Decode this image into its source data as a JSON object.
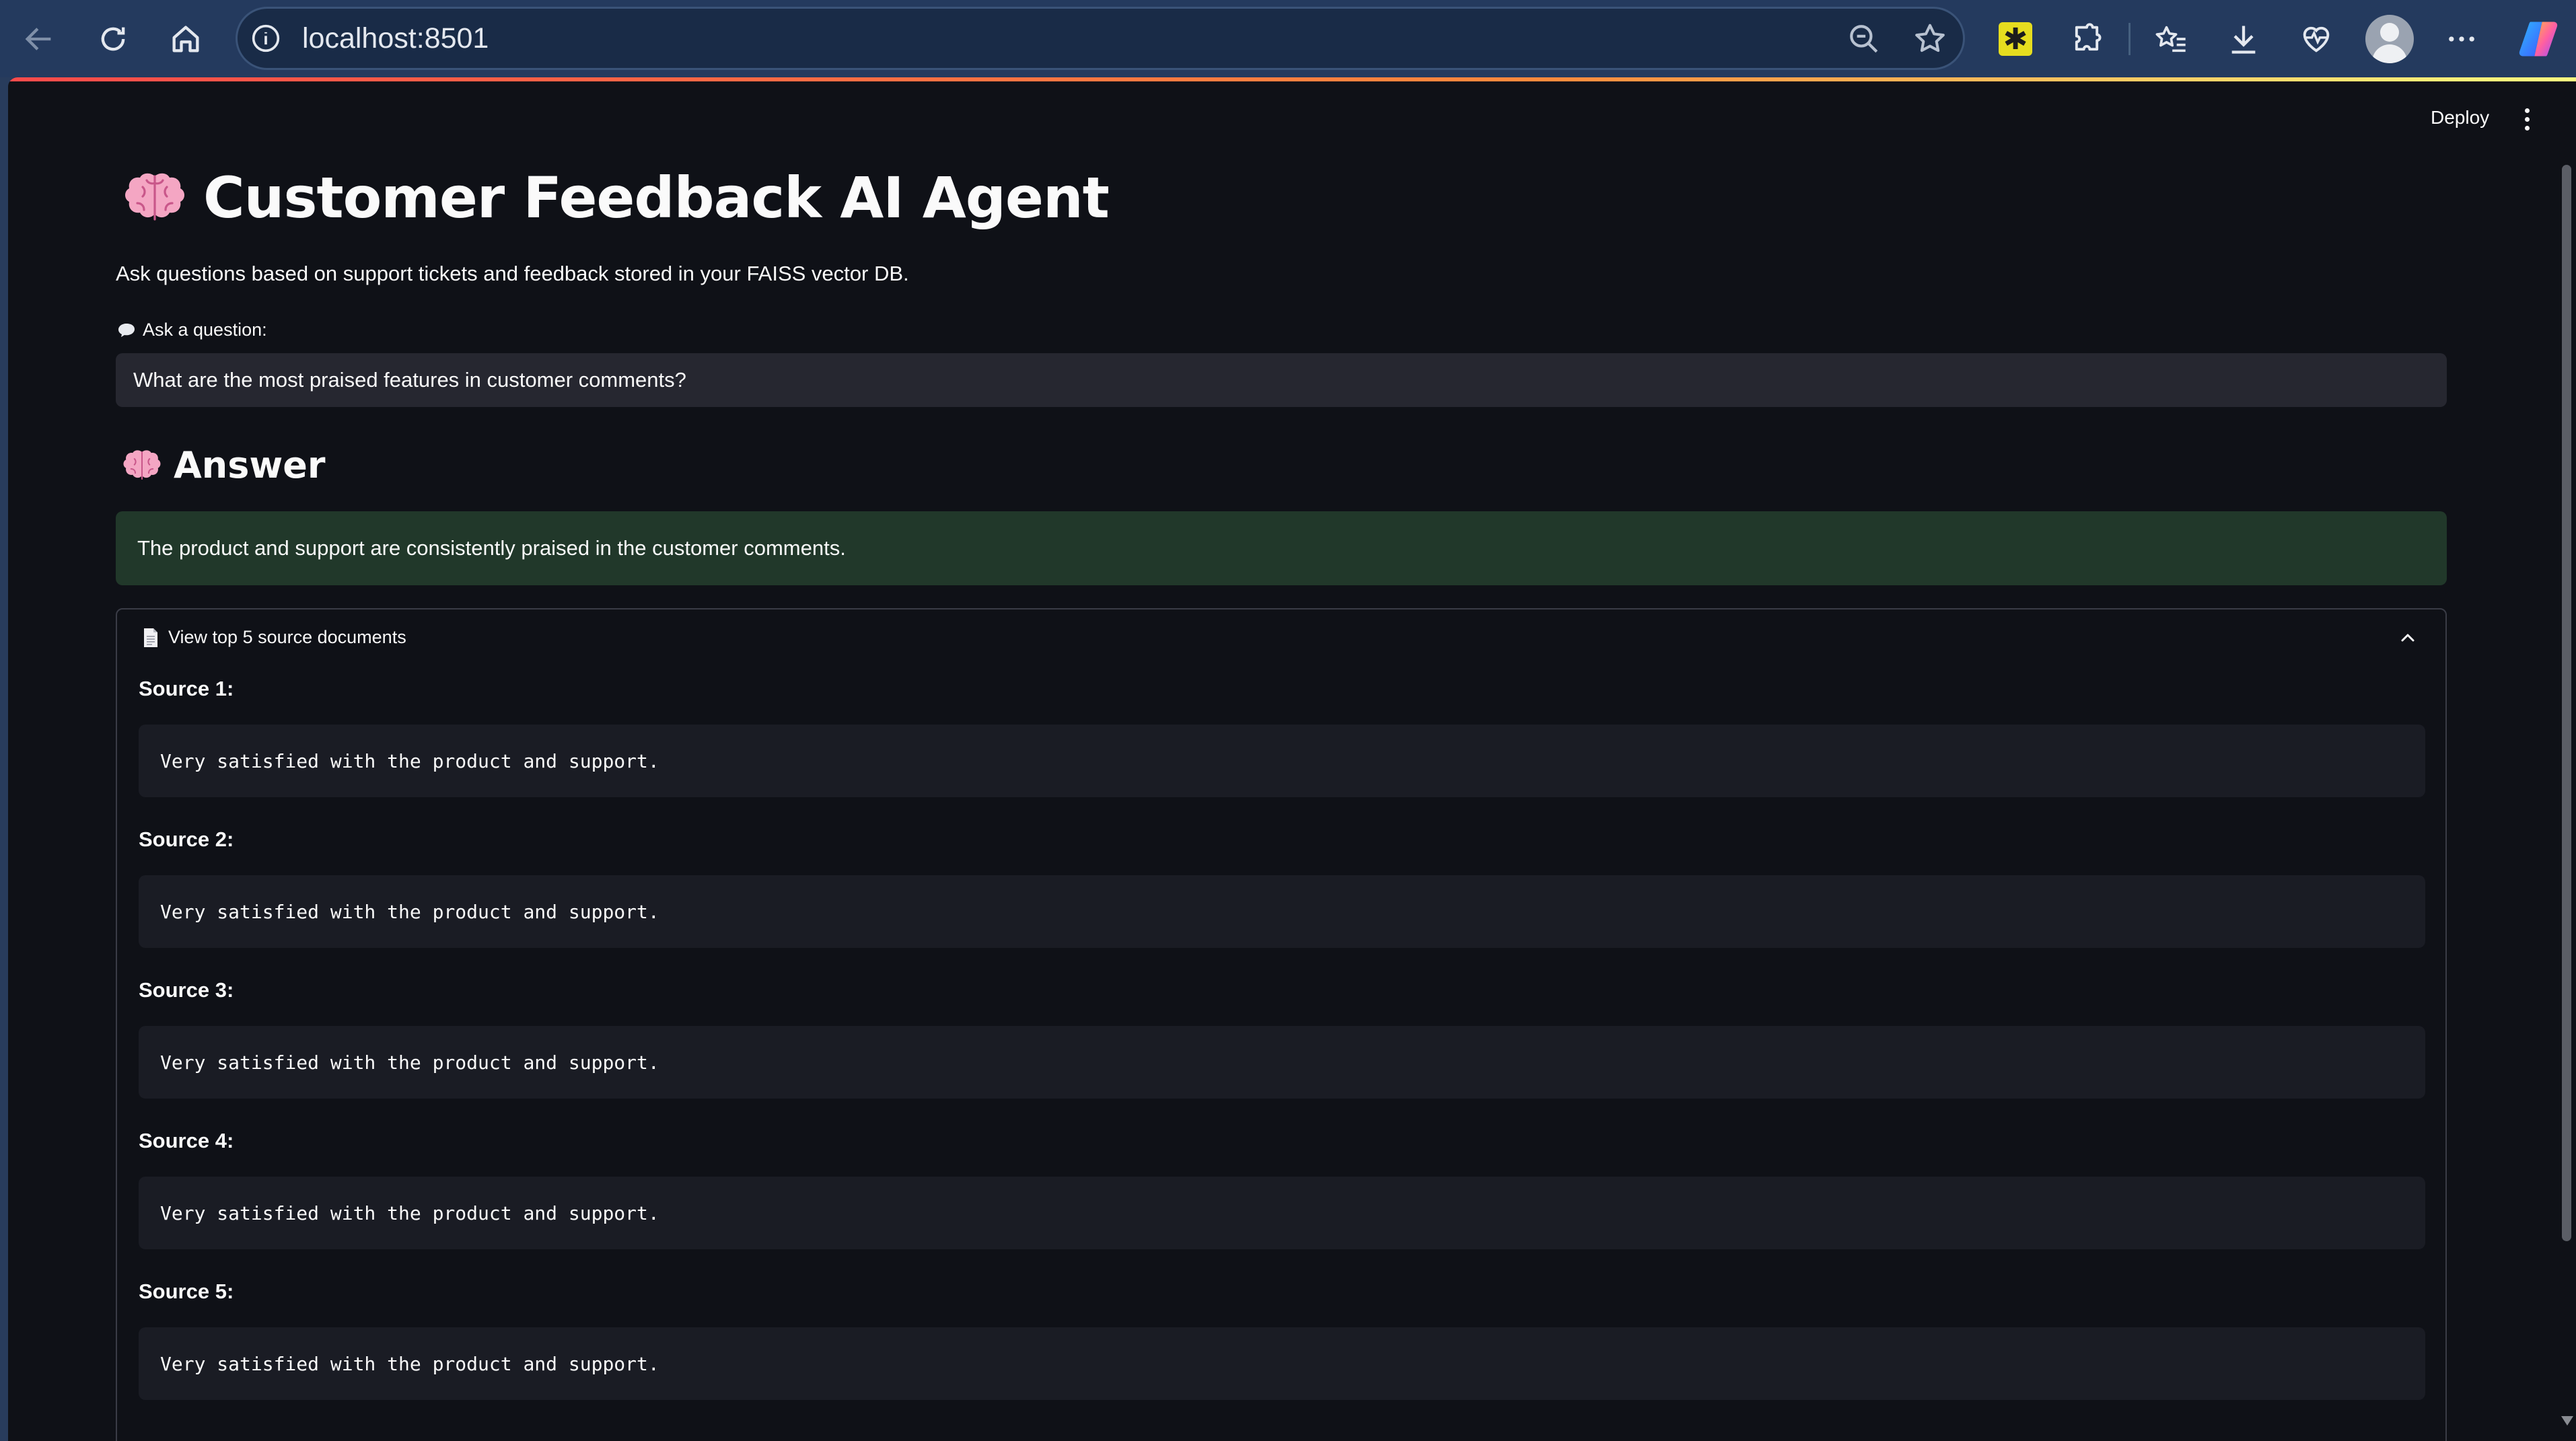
{
  "browser": {
    "url": "localhost:8501"
  },
  "app": {
    "deploy_label": "Deploy",
    "title": "Customer Feedback AI Agent",
    "subtitle": "Ask questions based on support tickets and feedback stored in your FAISS vector DB.",
    "question_label": "Ask a question:",
    "question_value": "What are the most praised features in customer comments?",
    "answer_heading": "Answer",
    "answer_text": "The product and support are consistently praised in the customer comments.",
    "sources_expander_label": "View top 5 source documents",
    "sources": [
      {
        "label": "Source 1:",
        "text": "Very satisfied with the product and support."
      },
      {
        "label": "Source 2:",
        "text": "Very satisfied with the product and support."
      },
      {
        "label": "Source 3:",
        "text": "Very satisfied with the product and support."
      },
      {
        "label": "Source 4:",
        "text": "Very satisfied with the product and support."
      },
      {
        "label": "Source 5:",
        "text": "Very satisfied with the product and support."
      }
    ]
  },
  "icons": {
    "title": "brain-icon",
    "question": "speech-bubble-icon",
    "expander": "document-icon"
  },
  "colors": {
    "page_bg": "#0f1117",
    "input_bg": "#262730",
    "success_bg": "#21382a",
    "code_bg": "#1a1c24",
    "browser_chrome": "#243a5e"
  }
}
